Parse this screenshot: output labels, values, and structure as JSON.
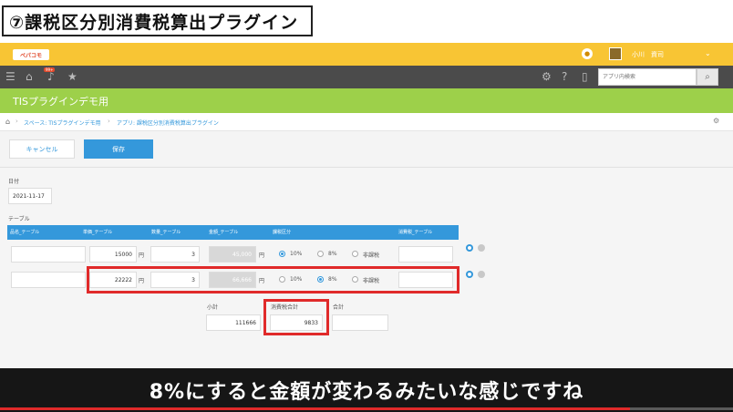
{
  "video_title": "⑦課税区分別消費税算出プラグイン",
  "header": {
    "logo_text": "ペパコモ",
    "notification_icon": "bell-icon",
    "user_name": "小川　資司"
  },
  "nav": {
    "badge": "99+",
    "search_placeholder": "アプリ内検索"
  },
  "app_title": "TISプラグインデモ用",
  "breadcrumb": {
    "space": "スペース: TISプラグインデモ用",
    "app": "アプリ: 課税区分別消費税算出プラグイン"
  },
  "actions": {
    "cancel_label": "キャンセル",
    "save_label": "保存"
  },
  "form": {
    "date_label": "日付",
    "date_value": "2021-11-17",
    "table_label": "テーブル",
    "columns": {
      "item": "品名_テーブル",
      "unit_price": "単価_テーブル",
      "quantity": "数量_テーブル",
      "amount": "金額_テーブル",
      "tax_class": "課税区分",
      "tax": "消費税_テーブル"
    },
    "currency_unit": "円",
    "tax_options": [
      "10%",
      "8%",
      "非課税"
    ],
    "rows": [
      {
        "item": "",
        "unit_price": "15000",
        "quantity": "3",
        "amount": "45,000",
        "selected": "10%",
        "tax": ""
      },
      {
        "item": "",
        "unit_price": "22222",
        "quantity": "3",
        "amount": "66,666",
        "selected": "8%",
        "tax": ""
      }
    ],
    "subtotal_label": "小計",
    "subtotal_value": "111666",
    "tax_total_label": "消費税合計",
    "tax_total_value": "9833",
    "total_label": "合計",
    "total_value": ""
  },
  "caption": "8%にすると金額が変わるみたいな感じですね",
  "colors": {
    "header_yellow": "#f8c534",
    "nav_dark": "#4b4b4b",
    "app_green": "#9dd04a",
    "primary_blue": "#3498db",
    "highlight_red": "#e02a2a"
  }
}
